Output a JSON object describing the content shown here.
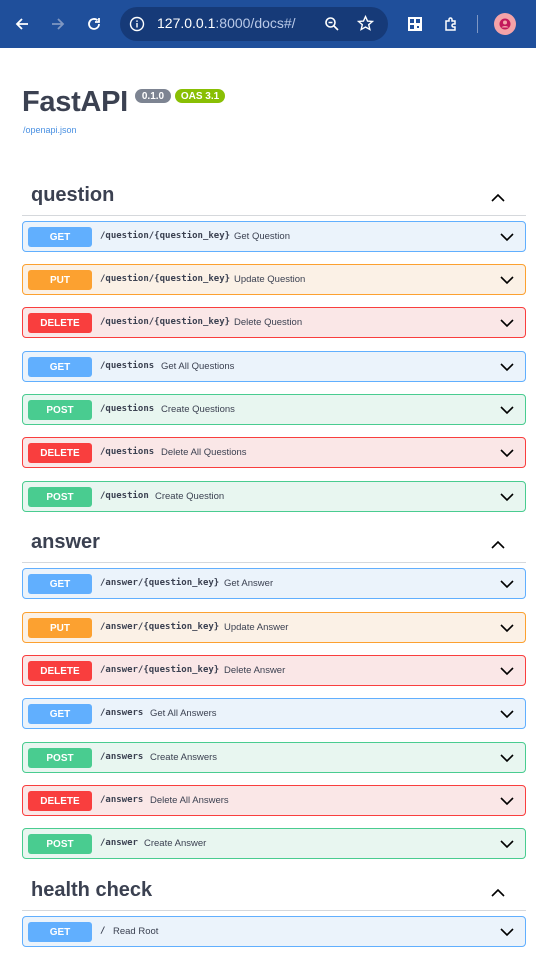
{
  "browser": {
    "url_host": "127.0.0.1",
    "url_rest": ":8000/docs#/"
  },
  "api": {
    "title": "FastAPI",
    "version": "0.1.0",
    "oas": "OAS 3.1",
    "spec_link": "/openapi.json"
  },
  "sections": [
    {
      "name": "question",
      "ops": [
        {
          "method": "GET",
          "path": "/question/{question_key}",
          "summary": "Get Question"
        },
        {
          "method": "PUT",
          "path": "/question/{question_key}",
          "summary": "Update Question"
        },
        {
          "method": "DELETE",
          "path": "/question/{question_key}",
          "summary": "Delete Question"
        },
        {
          "method": "GET",
          "path": "/questions",
          "summary": "Get All Questions"
        },
        {
          "method": "POST",
          "path": "/questions",
          "summary": "Create Questions"
        },
        {
          "method": "DELETE",
          "path": "/questions",
          "summary": "Delete All Questions"
        },
        {
          "method": "POST",
          "path": "/question",
          "summary": "Create Question"
        }
      ]
    },
    {
      "name": "answer",
      "ops": [
        {
          "method": "GET",
          "path": "/answer/{question_key}",
          "summary": "Get Answer"
        },
        {
          "method": "PUT",
          "path": "/answer/{question_key}",
          "summary": "Update Answer"
        },
        {
          "method": "DELETE",
          "path": "/answer/{question_key}",
          "summary": "Delete Answer"
        },
        {
          "method": "GET",
          "path": "/answers",
          "summary": "Get All Answers"
        },
        {
          "method": "POST",
          "path": "/answers",
          "summary": "Create Answers"
        },
        {
          "method": "DELETE",
          "path": "/answers",
          "summary": "Delete All Answers"
        },
        {
          "method": "POST",
          "path": "/answer",
          "summary": "Create Answer"
        }
      ]
    },
    {
      "name": "health check",
      "ops": [
        {
          "method": "GET",
          "path": "/",
          "summary": "Read Root"
        }
      ]
    }
  ],
  "colors": {
    "get": "#61affe",
    "put": "#fca130",
    "delete": "#f93e3e",
    "post": "#49cc90",
    "chrome": "#1f4f9b"
  }
}
